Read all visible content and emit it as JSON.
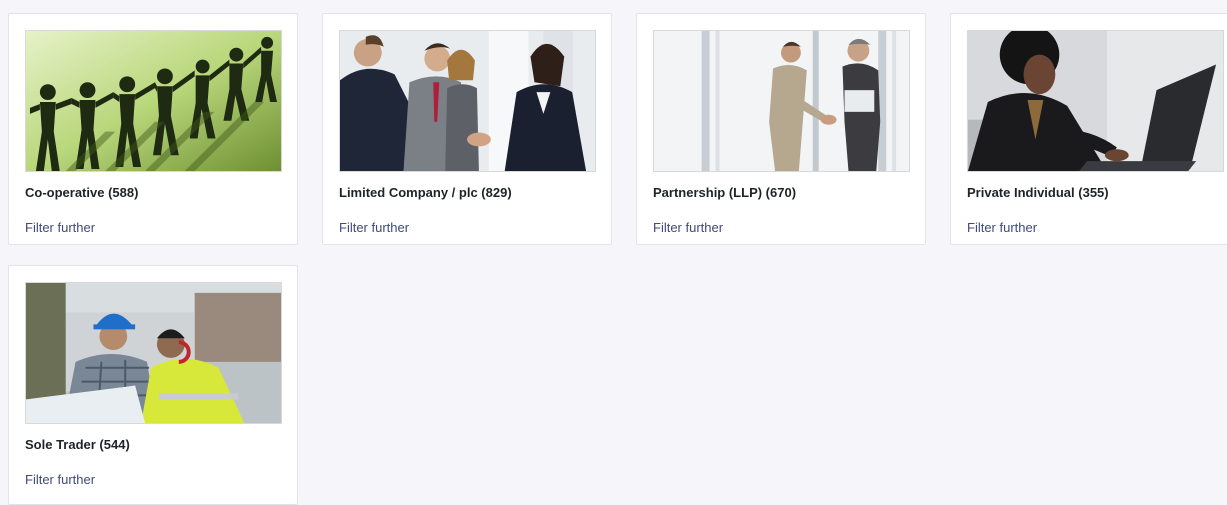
{
  "cards": [
    {
      "title": "Co-operative (588)",
      "link": "Filter further",
      "image": "paper-chain-people"
    },
    {
      "title": "Limited Company / plc (829)",
      "link": "Filter further",
      "image": "business-group-handshake"
    },
    {
      "title": "Partnership (LLP) (670)",
      "link": "Filter further",
      "image": "two-men-handshake"
    },
    {
      "title": "Private Individual (355)",
      "link": "Filter further",
      "image": "woman-at-laptop"
    },
    {
      "title": "Sole Trader (544)",
      "link": "Filter further",
      "image": "construction-workers"
    }
  ]
}
